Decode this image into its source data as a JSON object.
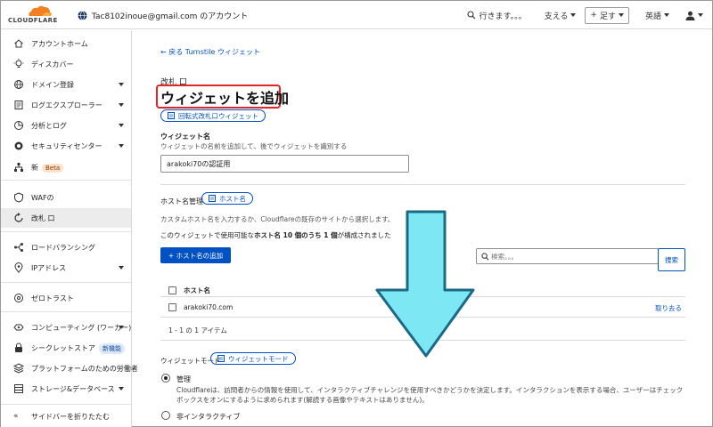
{
  "topbar": {
    "logo_text": "CLOUDFLARE",
    "account": "Tac8102inoue@gmail.com のアカウント",
    "search": "行きます。。。",
    "support": "支える",
    "add": "足す",
    "language": "英語"
  },
  "sidebar": {
    "items": [
      {
        "label": "アカウントホーム",
        "icon": "home-icon"
      },
      {
        "label": "ディスカバー",
        "icon": "lightbulb-icon"
      },
      {
        "label": "ドメイン登録",
        "icon": "globe-icon"
      },
      {
        "label": "ログエクスプローラー",
        "icon": "log-icon"
      },
      {
        "label": "分析とログ",
        "icon": "analytics-icon"
      },
      {
        "label": "セキュリティセンター",
        "icon": "shield-icon"
      },
      {
        "label": "新",
        "icon": "sitemap-icon",
        "badge": "Beta"
      },
      {
        "label": "WAFの",
        "icon": "waf-icon"
      },
      {
        "label": "改札 口",
        "icon": "turnstile-icon"
      },
      {
        "label": "ロードバランシング",
        "icon": "load-balancing-icon"
      },
      {
        "label": "IPアドレス",
        "icon": "location-pin-icon"
      },
      {
        "label": "ゼロトラスト",
        "icon": "zero-trust-icon"
      },
      {
        "label": "コンピューティング (ワーカー)",
        "icon": "compute-icon"
      },
      {
        "label": "シークレットストア",
        "icon": "secret-store-icon",
        "badge": "新機能"
      },
      {
        "label": "プラットフォームのための労働者",
        "icon": "worker-platform-icon"
      },
      {
        "label": "ストレージ&データベース",
        "icon": "storage-icon"
      }
    ],
    "collapse": "サイドバーを折りたたむ"
  },
  "main": {
    "back_link": "← 戻る Turnstile ウィジェット",
    "pre_title": "改札 口",
    "title": "ウィジェットを追加",
    "title_pill": "回転式改札口ウィジェット",
    "widget_name_label": "ウィジェット名",
    "widget_name_help": "ウィジェットの名前を追加して、後でウィジェットを識別する",
    "widget_name_value": "arakoki70の認証用",
    "hostname_label": "ホスト名管理",
    "hostname_pill": "ホスト名",
    "hostname_help": "カスタムホスト名を入力するか、Cloudflareの既存のサイトから選択します。",
    "hostname_count_pre": "このウィジェットで使用可能な",
    "hostname_count_bold": "ホスト名 10 個のうち 1 個",
    "hostname_count_post": "が構成されました",
    "add_hostname_button": "+ ホスト名の追加",
    "search_placeholder": "検索。。。",
    "search_button": "捜索",
    "table_header": "ホスト名",
    "rows": [
      {
        "hostname": "arakoki70.com",
        "action": "取り去る"
      }
    ],
    "pagination": "1 - 1 の 1 アイテム",
    "mode_label": "ウィジェットモード",
    "mode_pill": "ウィジェットモード",
    "options": [
      {
        "title": "管理",
        "selected": true,
        "desc": "Cloudflareは、訪問者からの情報を使用して、インタラクティブチャレンジを使用すべきかどうかを決定します。インタラクションを表示する場合、ユーザーはチェックボックスをオンにするように求められます(解読する画像やテキストはありません)。"
      },
      {
        "title": "非インタラクティブ",
        "selected": false,
        "desc": ""
      }
    ]
  },
  "colors": {
    "accent": "#0051c3",
    "highlight": "#e0262a",
    "arrow_fill": "#7de8f4",
    "arrow_stroke": "#1a6a86"
  }
}
